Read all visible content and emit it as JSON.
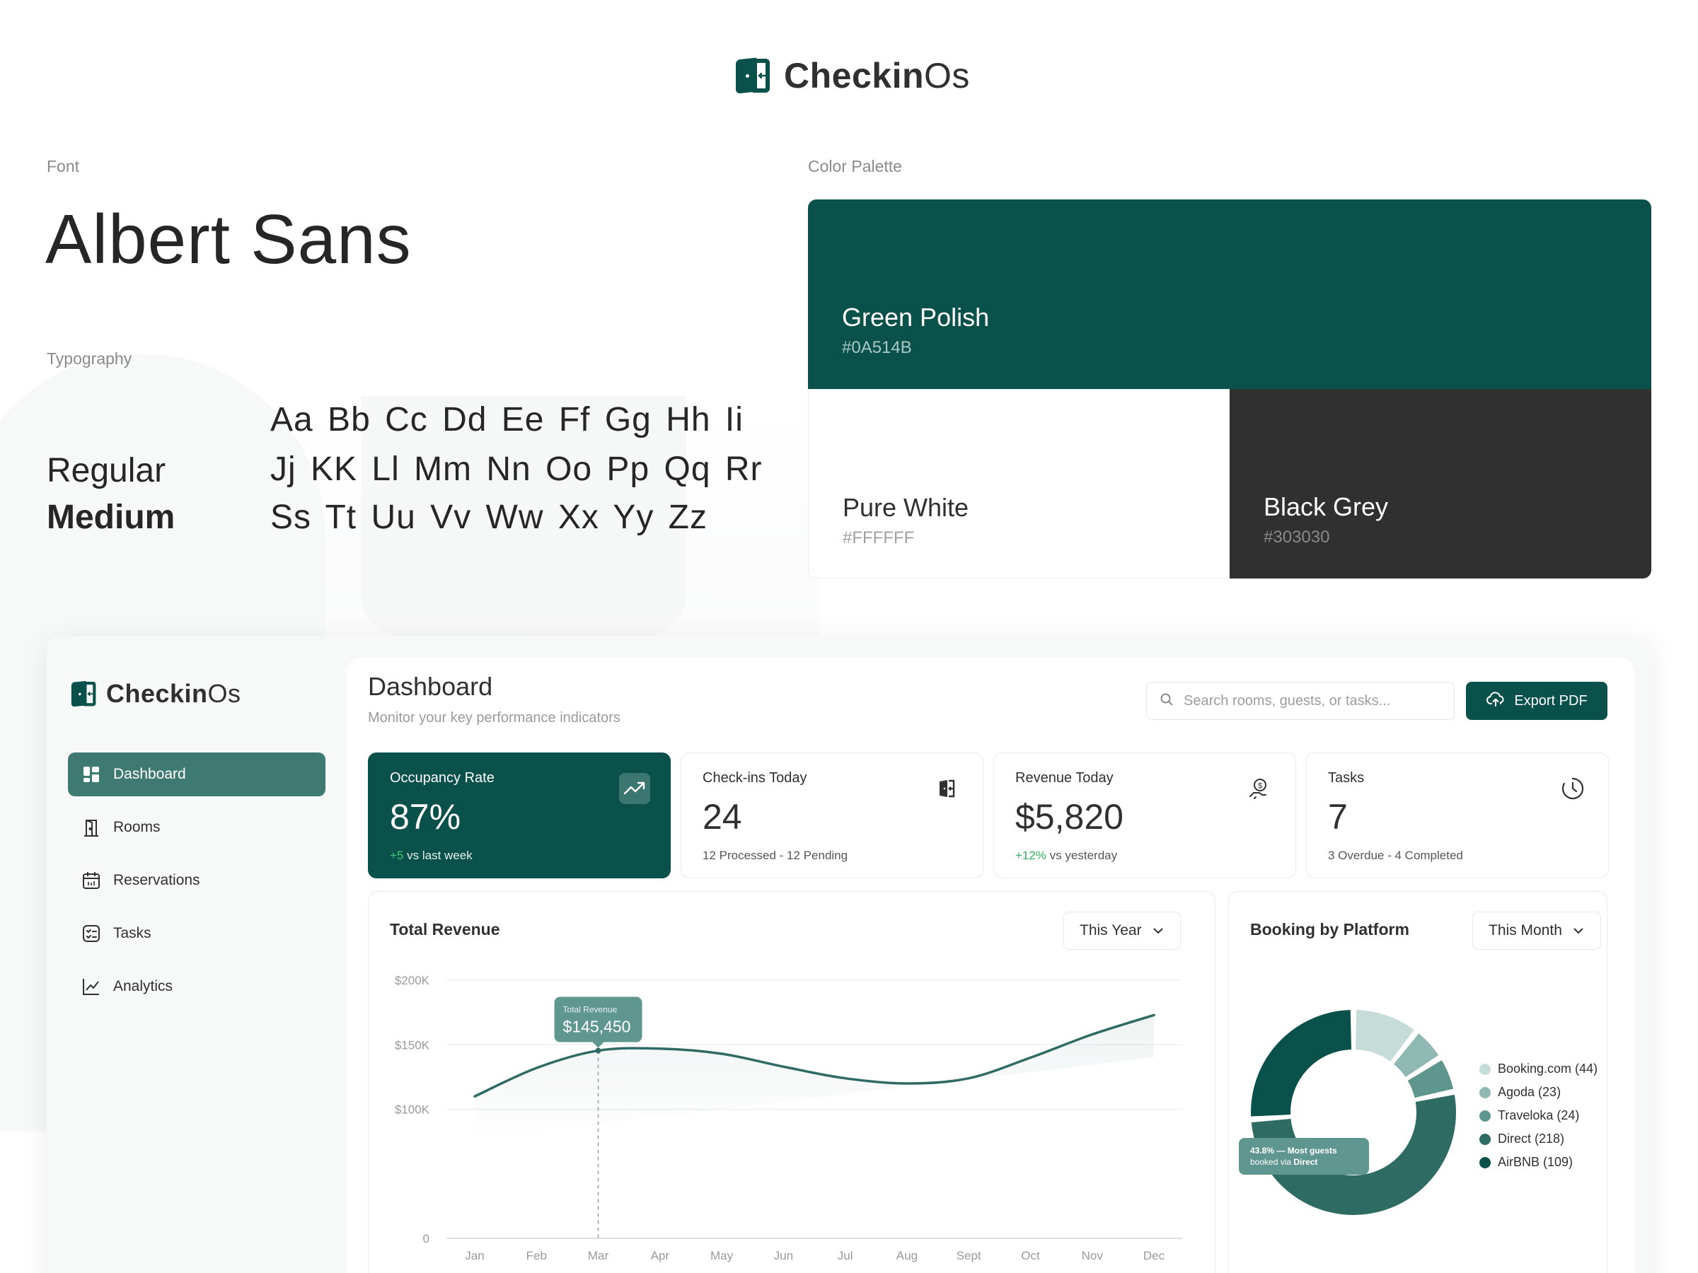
{
  "brand": {
    "name_bold": "Checkin",
    "name_light": "Os"
  },
  "style_guide": {
    "font_label": "Font",
    "font_name": "Albert Sans",
    "typography_label": "Typography",
    "weights": [
      "Regular",
      "Medium"
    ],
    "alphabet_lines": [
      "Aa Bb Cc Dd Ee Ff Gg Hh Ii",
      "Jj KK Ll Mm Nn Oo Pp Qq Rr",
      "Ss Tt Uu Vv Ww Xx Yy Zz"
    ],
    "palette_label": "Color Palette",
    "colors": [
      {
        "name": "Green Polish",
        "hex": "#0A514B"
      },
      {
        "name": "Pure White",
        "hex": "#FFFFFF"
      },
      {
        "name": "Black Grey",
        "hex": "#303030"
      }
    ]
  },
  "sidebar": {
    "items": [
      {
        "label": "Dashboard",
        "icon": "dashboard-icon",
        "active": true
      },
      {
        "label": "Rooms",
        "icon": "door-icon"
      },
      {
        "label": "Reservations",
        "icon": "calendar-icon"
      },
      {
        "label": "Tasks",
        "icon": "checklist-icon"
      },
      {
        "label": "Analytics",
        "icon": "line-chart-icon"
      }
    ]
  },
  "header": {
    "title": "Dashboard",
    "subtitle": "Monitor your key performance indicators",
    "search_placeholder": "Search rooms, guests, or tasks...",
    "export_label": "Export PDF"
  },
  "stats": [
    {
      "title": "Occupancy Rate",
      "value": "87%",
      "delta": "+5",
      "foot": " vs last week",
      "icon": "trend-up-icon"
    },
    {
      "title": "Check-ins Today",
      "value": "24",
      "delta": "",
      "foot": "12 Processed - 12 Pending",
      "icon": "checkin-door-icon"
    },
    {
      "title": "Revenue Today",
      "value": "$5,820",
      "delta": "+12%",
      "foot": " vs yesterday",
      "icon": "money-hand-icon"
    },
    {
      "title": "Tasks",
      "value": "7",
      "delta": "",
      "foot": "3 Overdue - 4 Completed",
      "icon": "clock-icon"
    }
  ],
  "revenue_panel": {
    "title": "Total Revenue",
    "filter": "This Year",
    "tooltip_label": "Total Revenue",
    "tooltip_value": "$145,450",
    "highlight_month": "Mar"
  },
  "platform_panel": {
    "title": "Booking by Platform",
    "filter": "This Month",
    "callout_line1": "43.8% — Most guests",
    "callout_line2_prefix": "booked via ",
    "callout_line2_bold": "Direct"
  },
  "chart_data": [
    {
      "type": "line",
      "title": "Total Revenue",
      "x": [
        "Jan",
        "Feb",
        "Mar",
        "Apr",
        "May",
        "Jun",
        "Jul",
        "Aug",
        "Sept",
        "Oct",
        "Nov",
        "Dec"
      ],
      "series": [
        {
          "values": [
            110000,
            132000,
            145450,
            147000,
            143000,
            133000,
            124000,
            120000,
            124000,
            140000,
            158000,
            173000
          ]
        }
      ],
      "yticks": [
        "$200K",
        "$150K",
        "$100K",
        "0"
      ],
      "ylim": [
        0,
        200000
      ],
      "line_color": "#2f6b64"
    },
    {
      "type": "pie",
      "title": "Booking by Platform",
      "donut": true,
      "categories": [
        "Booking.com",
        "Agoda",
        "Traveloka",
        "Direct",
        "AirBNB"
      ],
      "values": [
        44,
        23,
        24,
        218,
        109
      ],
      "legend_labels": [
        "Booking.com (44)",
        "Agoda (23)",
        "Traveloka (24)",
        "Direct (218)",
        "AirBNB (109)"
      ],
      "colors": [
        "#c5dcd8",
        "#8fb8b2",
        "#5e958d",
        "#2e6b63",
        "#0A514B"
      ]
    }
  ]
}
